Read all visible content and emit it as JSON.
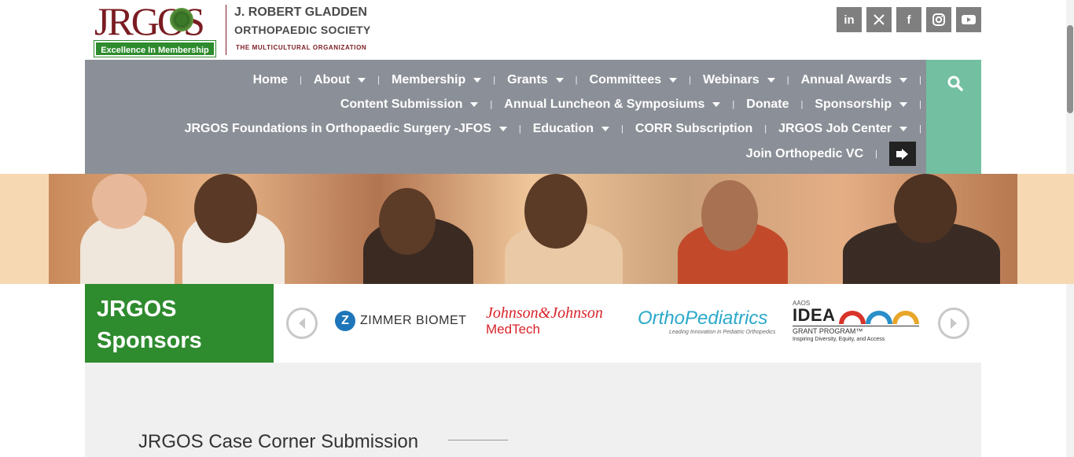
{
  "header": {
    "logo_wordmark": "JRGOS",
    "logo_tagline": "Excellence In Membership",
    "org_name_line1": "J. ROBERT GLADDEN",
    "org_name_line2": "ORTHOPAEDIC SOCIETY",
    "org_subtitle": "THE MULTICULTURAL ORGANIZATION",
    "social": [
      {
        "icon": "linkedin-icon",
        "glyph": "in"
      },
      {
        "icon": "x-twitter-icon",
        "glyph": "𝕏"
      },
      {
        "icon": "facebook-icon",
        "glyph": "f"
      },
      {
        "icon": "instagram-icon",
        "glyph": "◎"
      },
      {
        "icon": "youtube-icon",
        "glyph": "▶"
      }
    ]
  },
  "nav": {
    "rows": [
      [
        {
          "label": "Home",
          "dropdown": false
        },
        {
          "label": "About",
          "dropdown": true
        },
        {
          "label": "Membership",
          "dropdown": true
        },
        {
          "label": "Grants",
          "dropdown": true
        },
        {
          "label": "Committees",
          "dropdown": true
        },
        {
          "label": "Webinars",
          "dropdown": true
        },
        {
          "label": "Annual Awards",
          "dropdown": true
        }
      ],
      [
        {
          "label": "Content Submission",
          "dropdown": true
        },
        {
          "label": "Annual Luncheon & Symposiums",
          "dropdown": true
        },
        {
          "label": "Donate",
          "dropdown": false
        },
        {
          "label": "Sponsorship",
          "dropdown": true
        }
      ],
      [
        {
          "label": "JRGOS Foundations in Orthopaedic Surgery -JFOS",
          "dropdown": true
        },
        {
          "label": "Education",
          "dropdown": true
        },
        {
          "label": "CORR Subscription",
          "dropdown": false
        },
        {
          "label": "JRGOS Job Center",
          "dropdown": true
        }
      ],
      [
        {
          "label": "Join Orthopedic VC",
          "dropdown": false
        }
      ]
    ],
    "separator": "|",
    "login_icon": "login-icon",
    "search_icon": "search-icon"
  },
  "sponsors": {
    "title_line1": "JRGOS",
    "title_line2": "Sponsors",
    "zimmer": {
      "mark": "Z",
      "text": "ZIMMER BIOMET"
    },
    "jnj": {
      "line1": "Johnson&Johnson",
      "line2": "MedTech"
    },
    "orthopediatrics": {
      "name": "OrthoPediatrics",
      "tagline": "Leading Innovation in Pediatric Orthopedics"
    },
    "idea": {
      "top": "AAOS",
      "word": "IDEA",
      "grant": "GRANT PROGRAM™",
      "tagline": "Inspiring Diversity, Equity, and Access"
    }
  },
  "content": {
    "section_title": "JRGOS Case Corner Submission"
  },
  "colors": {
    "brand_red": "#7a1c22",
    "brand_green": "#2e8b2e",
    "nav_gray": "#8b9098",
    "search_teal": "#72c0a1"
  }
}
